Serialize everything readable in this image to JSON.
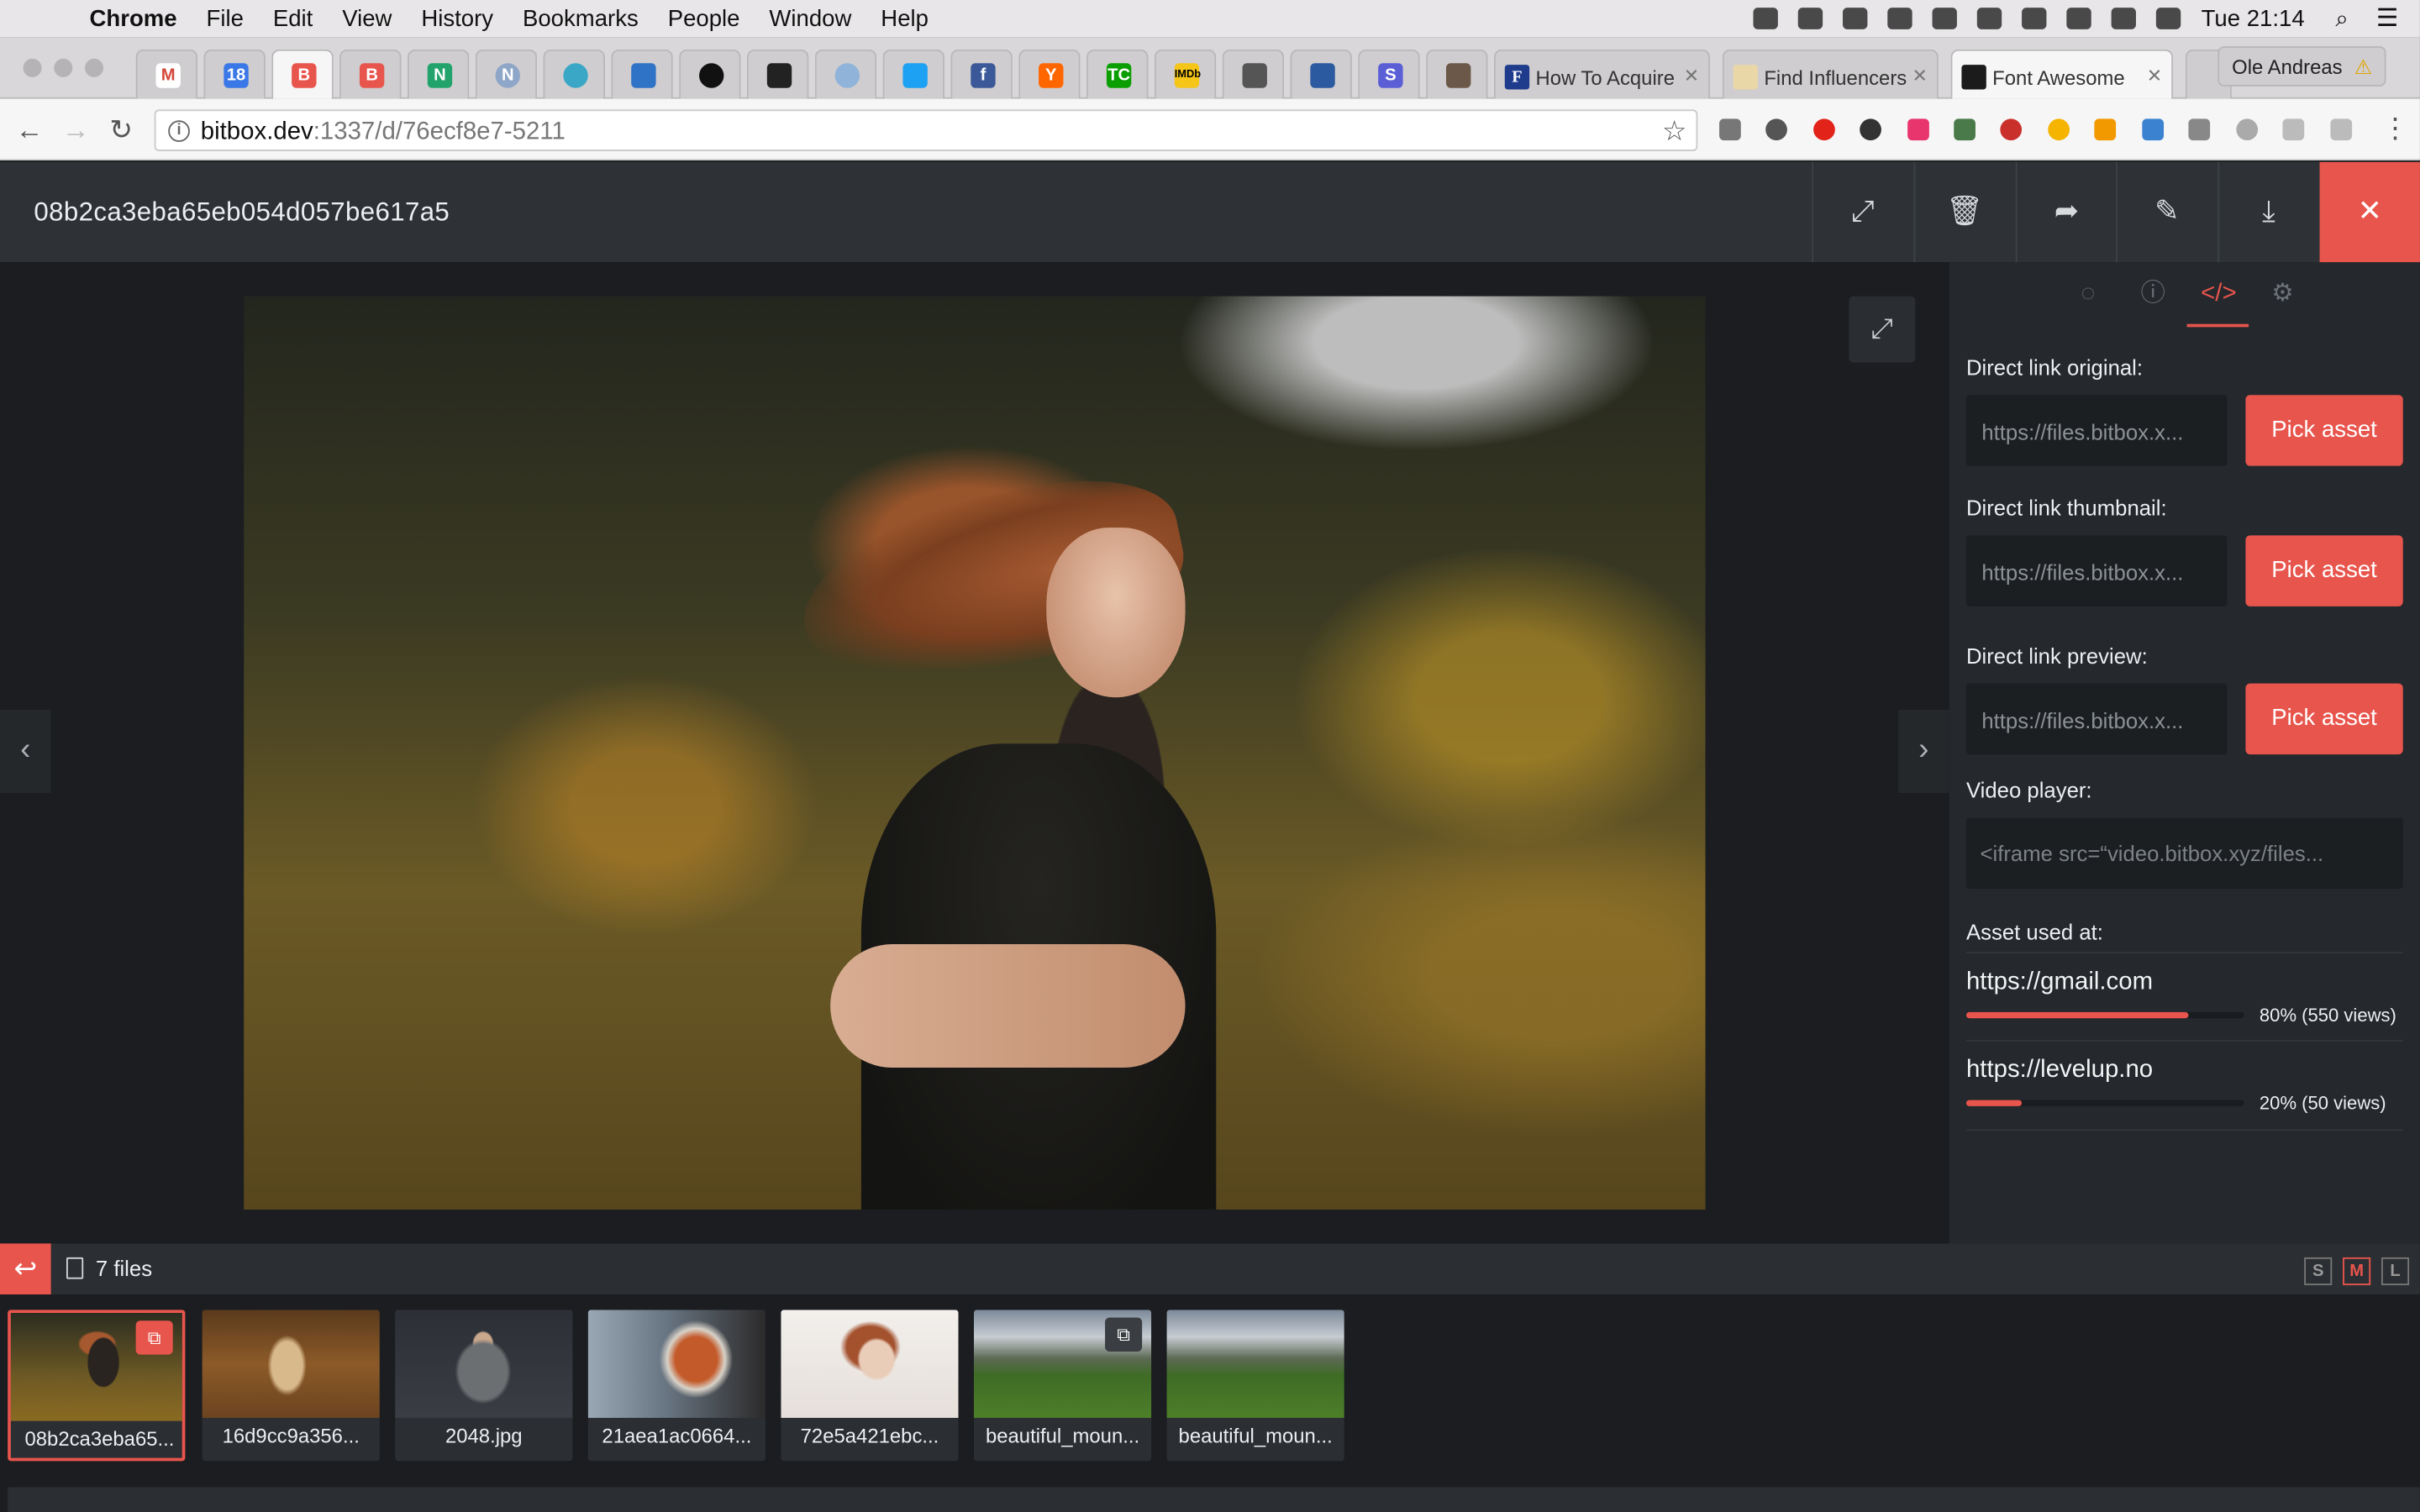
{
  "menubar": {
    "app": "Chrome",
    "items": [
      "File",
      "Edit",
      "View",
      "History",
      "Bookmarks",
      "People",
      "Window",
      "Help"
    ],
    "clock": "Tue 21:14"
  },
  "tabs": {
    "window_tabs": [
      {
        "title": "How To Acquire",
        "favicon": "F"
      },
      {
        "title": "Find Influencers",
        "favicon": ""
      },
      {
        "title": "Font Awesome",
        "favicon": ""
      }
    ],
    "profile": "Ole Andreas"
  },
  "address": {
    "host": "bitbox.dev",
    "path": ":1337/d/76ecf8e7-5211"
  },
  "header": {
    "title": "08b2ca3eba65eb054d057be617a5"
  },
  "panel": {
    "direct_original_label": "Direct link original:",
    "direct_original_value": "https://files.bitbox.x...",
    "direct_thumbnail_label": "Direct link thumbnail:",
    "direct_thumbnail_value": "https://files.bitbox.x...",
    "direct_preview_label": "Direct link preview:",
    "direct_preview_value": "https://files.bitbox.x...",
    "pick_asset": "Pick asset",
    "video_label": "Video player:",
    "video_value": "<iframe src=“video.bitbox.xyz/files...",
    "used_at_label": "Asset used at:",
    "usages": [
      {
        "url": "https://gmail.com",
        "percent": 80,
        "stat": "80% (550 views)"
      },
      {
        "url": "https://levelup.no",
        "percent": 20,
        "stat": "20% (50 views)"
      }
    ]
  },
  "filebar": {
    "count": "7 files",
    "sizes": [
      "S",
      "M",
      "L"
    ],
    "active_size": "M"
  },
  "thumbnails": [
    {
      "name": "08b2ca3eba65...",
      "selected": true
    },
    {
      "name": "16d9cc9a356...",
      "selected": false
    },
    {
      "name": "2048.jpg",
      "selected": false
    },
    {
      "name": "21aea1ac0664...",
      "selected": false
    },
    {
      "name": "72e5a421ebc...",
      "selected": false
    },
    {
      "name": "beautiful_moun...",
      "selected": false
    },
    {
      "name": "beautiful_moun...",
      "selected": false
    }
  ],
  "colors": {
    "accent": "#e8554d",
    "header": "#2e3236",
    "panel": "#25282c"
  }
}
